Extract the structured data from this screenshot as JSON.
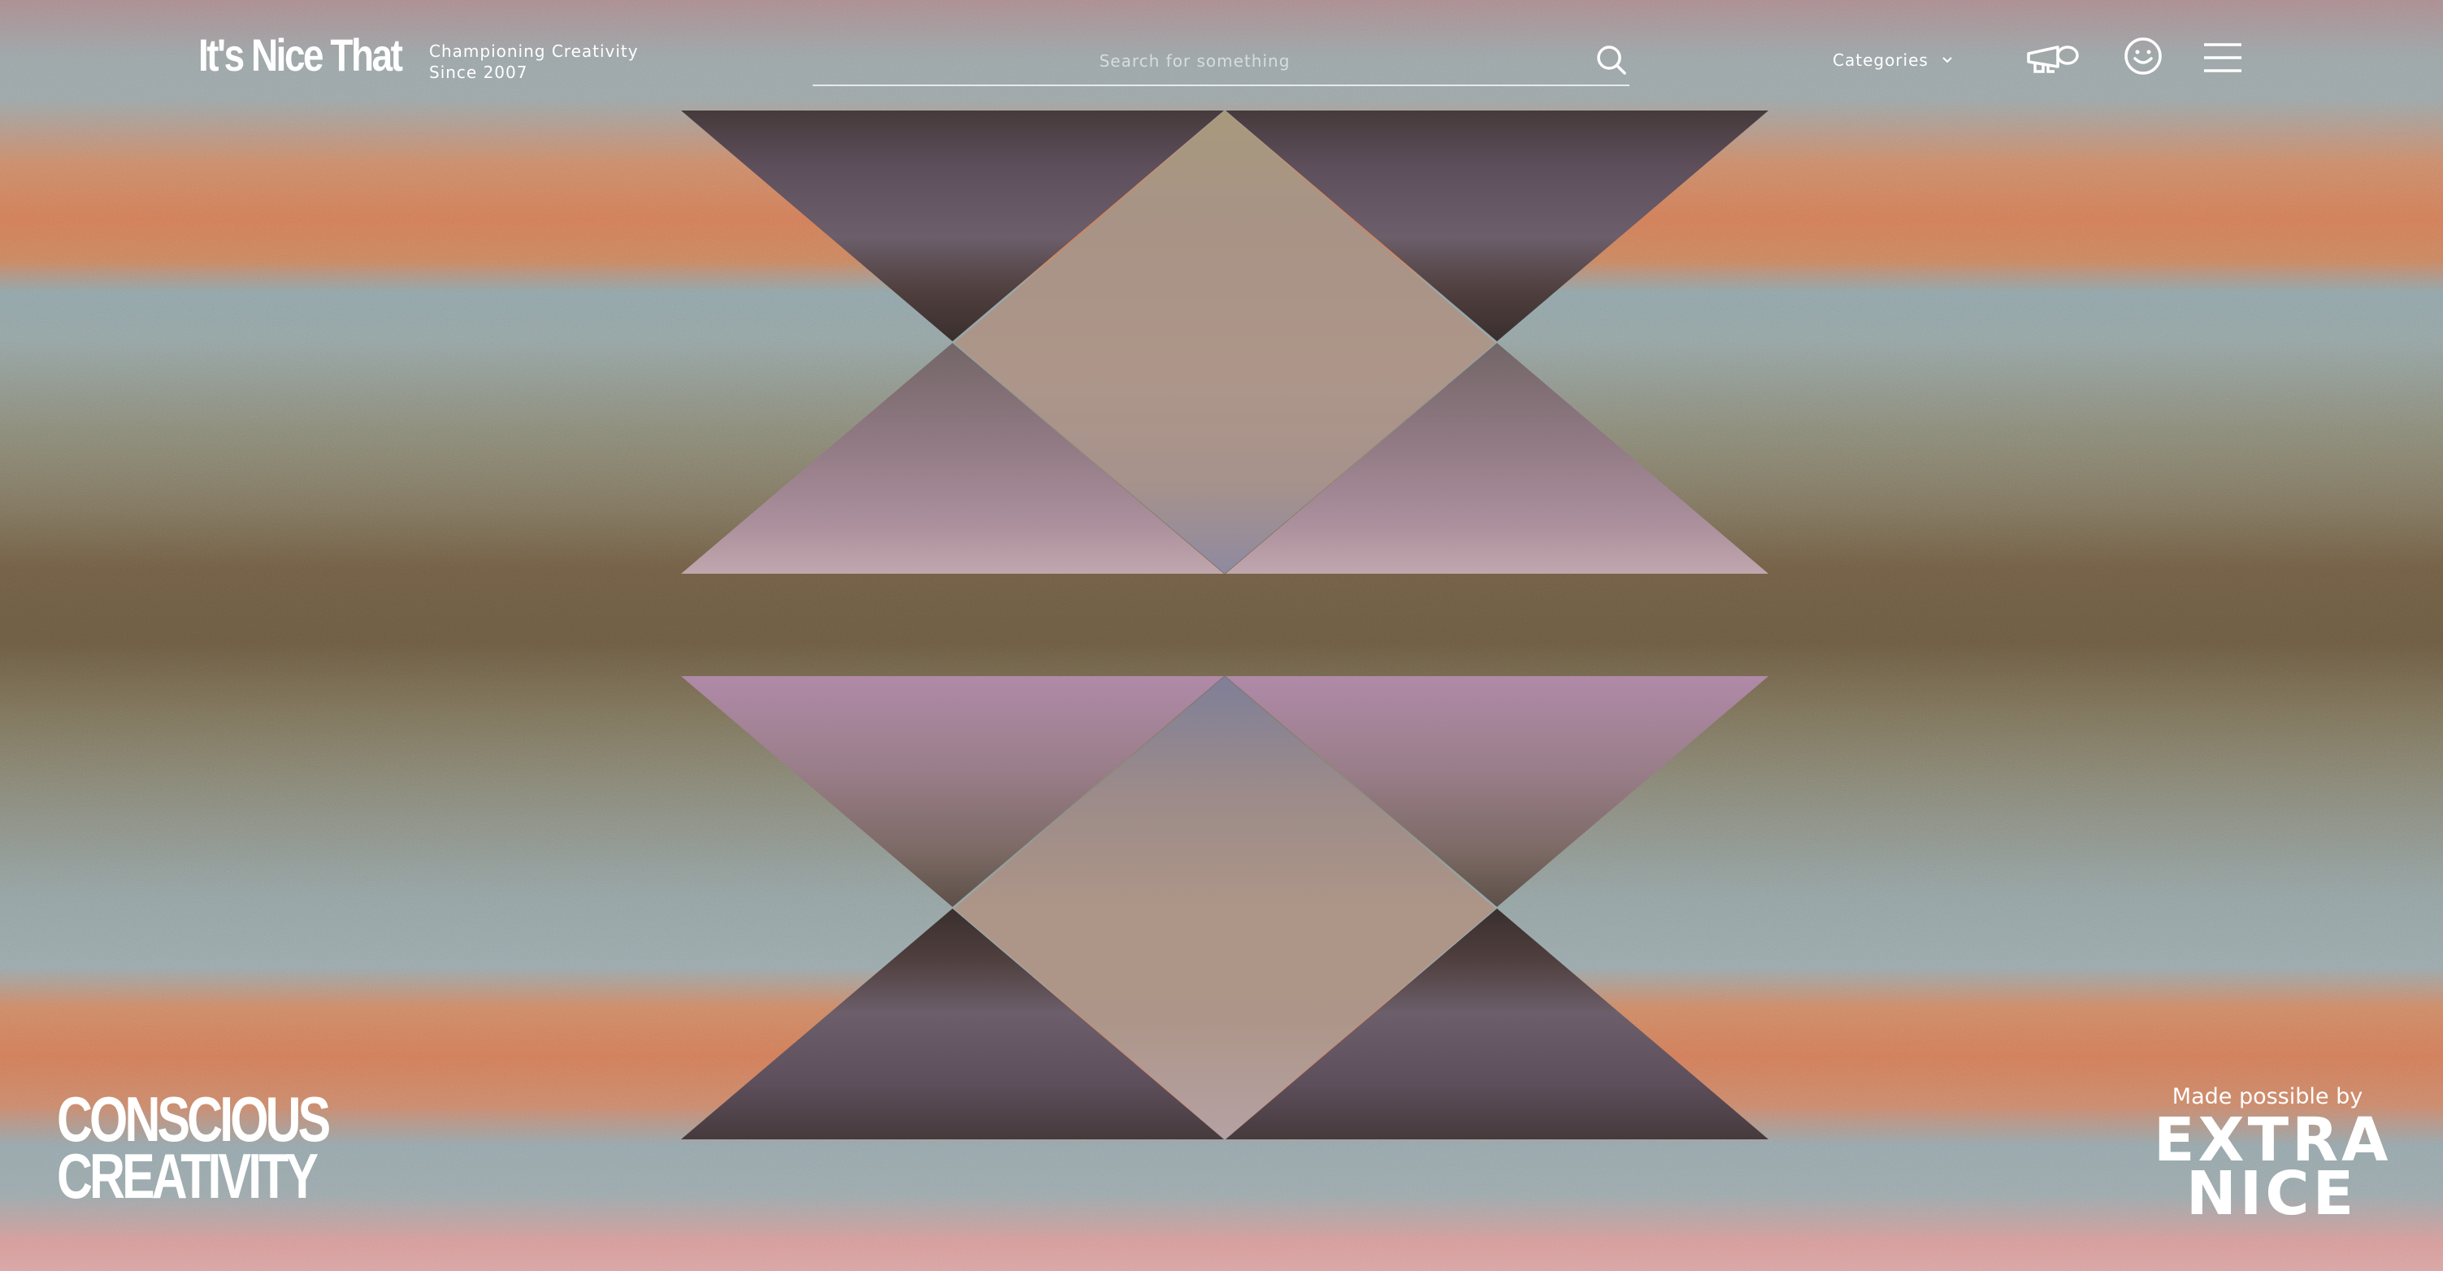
{
  "brand": {
    "logo_text": "It's Nice That",
    "tagline_line1": "Championing Creativity",
    "tagline_line2": "Since 2007"
  },
  "search": {
    "placeholder": "Search for something",
    "value": ""
  },
  "nav": {
    "categories_label": "Categories",
    "icons": [
      "megaphone-icon",
      "smiley-icon",
      "hamburger-menu-icon"
    ]
  },
  "campaign": {
    "line1": "CONSCIOUS",
    "line2": "CREATIVITY"
  },
  "sponsor": {
    "intro": "Made possible by",
    "name_line1": "EXTRA",
    "name_line2": "NICE"
  },
  "colors": {
    "text": "#ffffff",
    "band_orange": "#d07b57",
    "band_teal": "#94a5aa",
    "band_brown": "#6a5a42",
    "band_pink": "#d8a2a2",
    "triangle_dark": "#5e4f5c",
    "triangle_mauve": "#b08aa8",
    "diamond_pink": "#ad9587"
  }
}
